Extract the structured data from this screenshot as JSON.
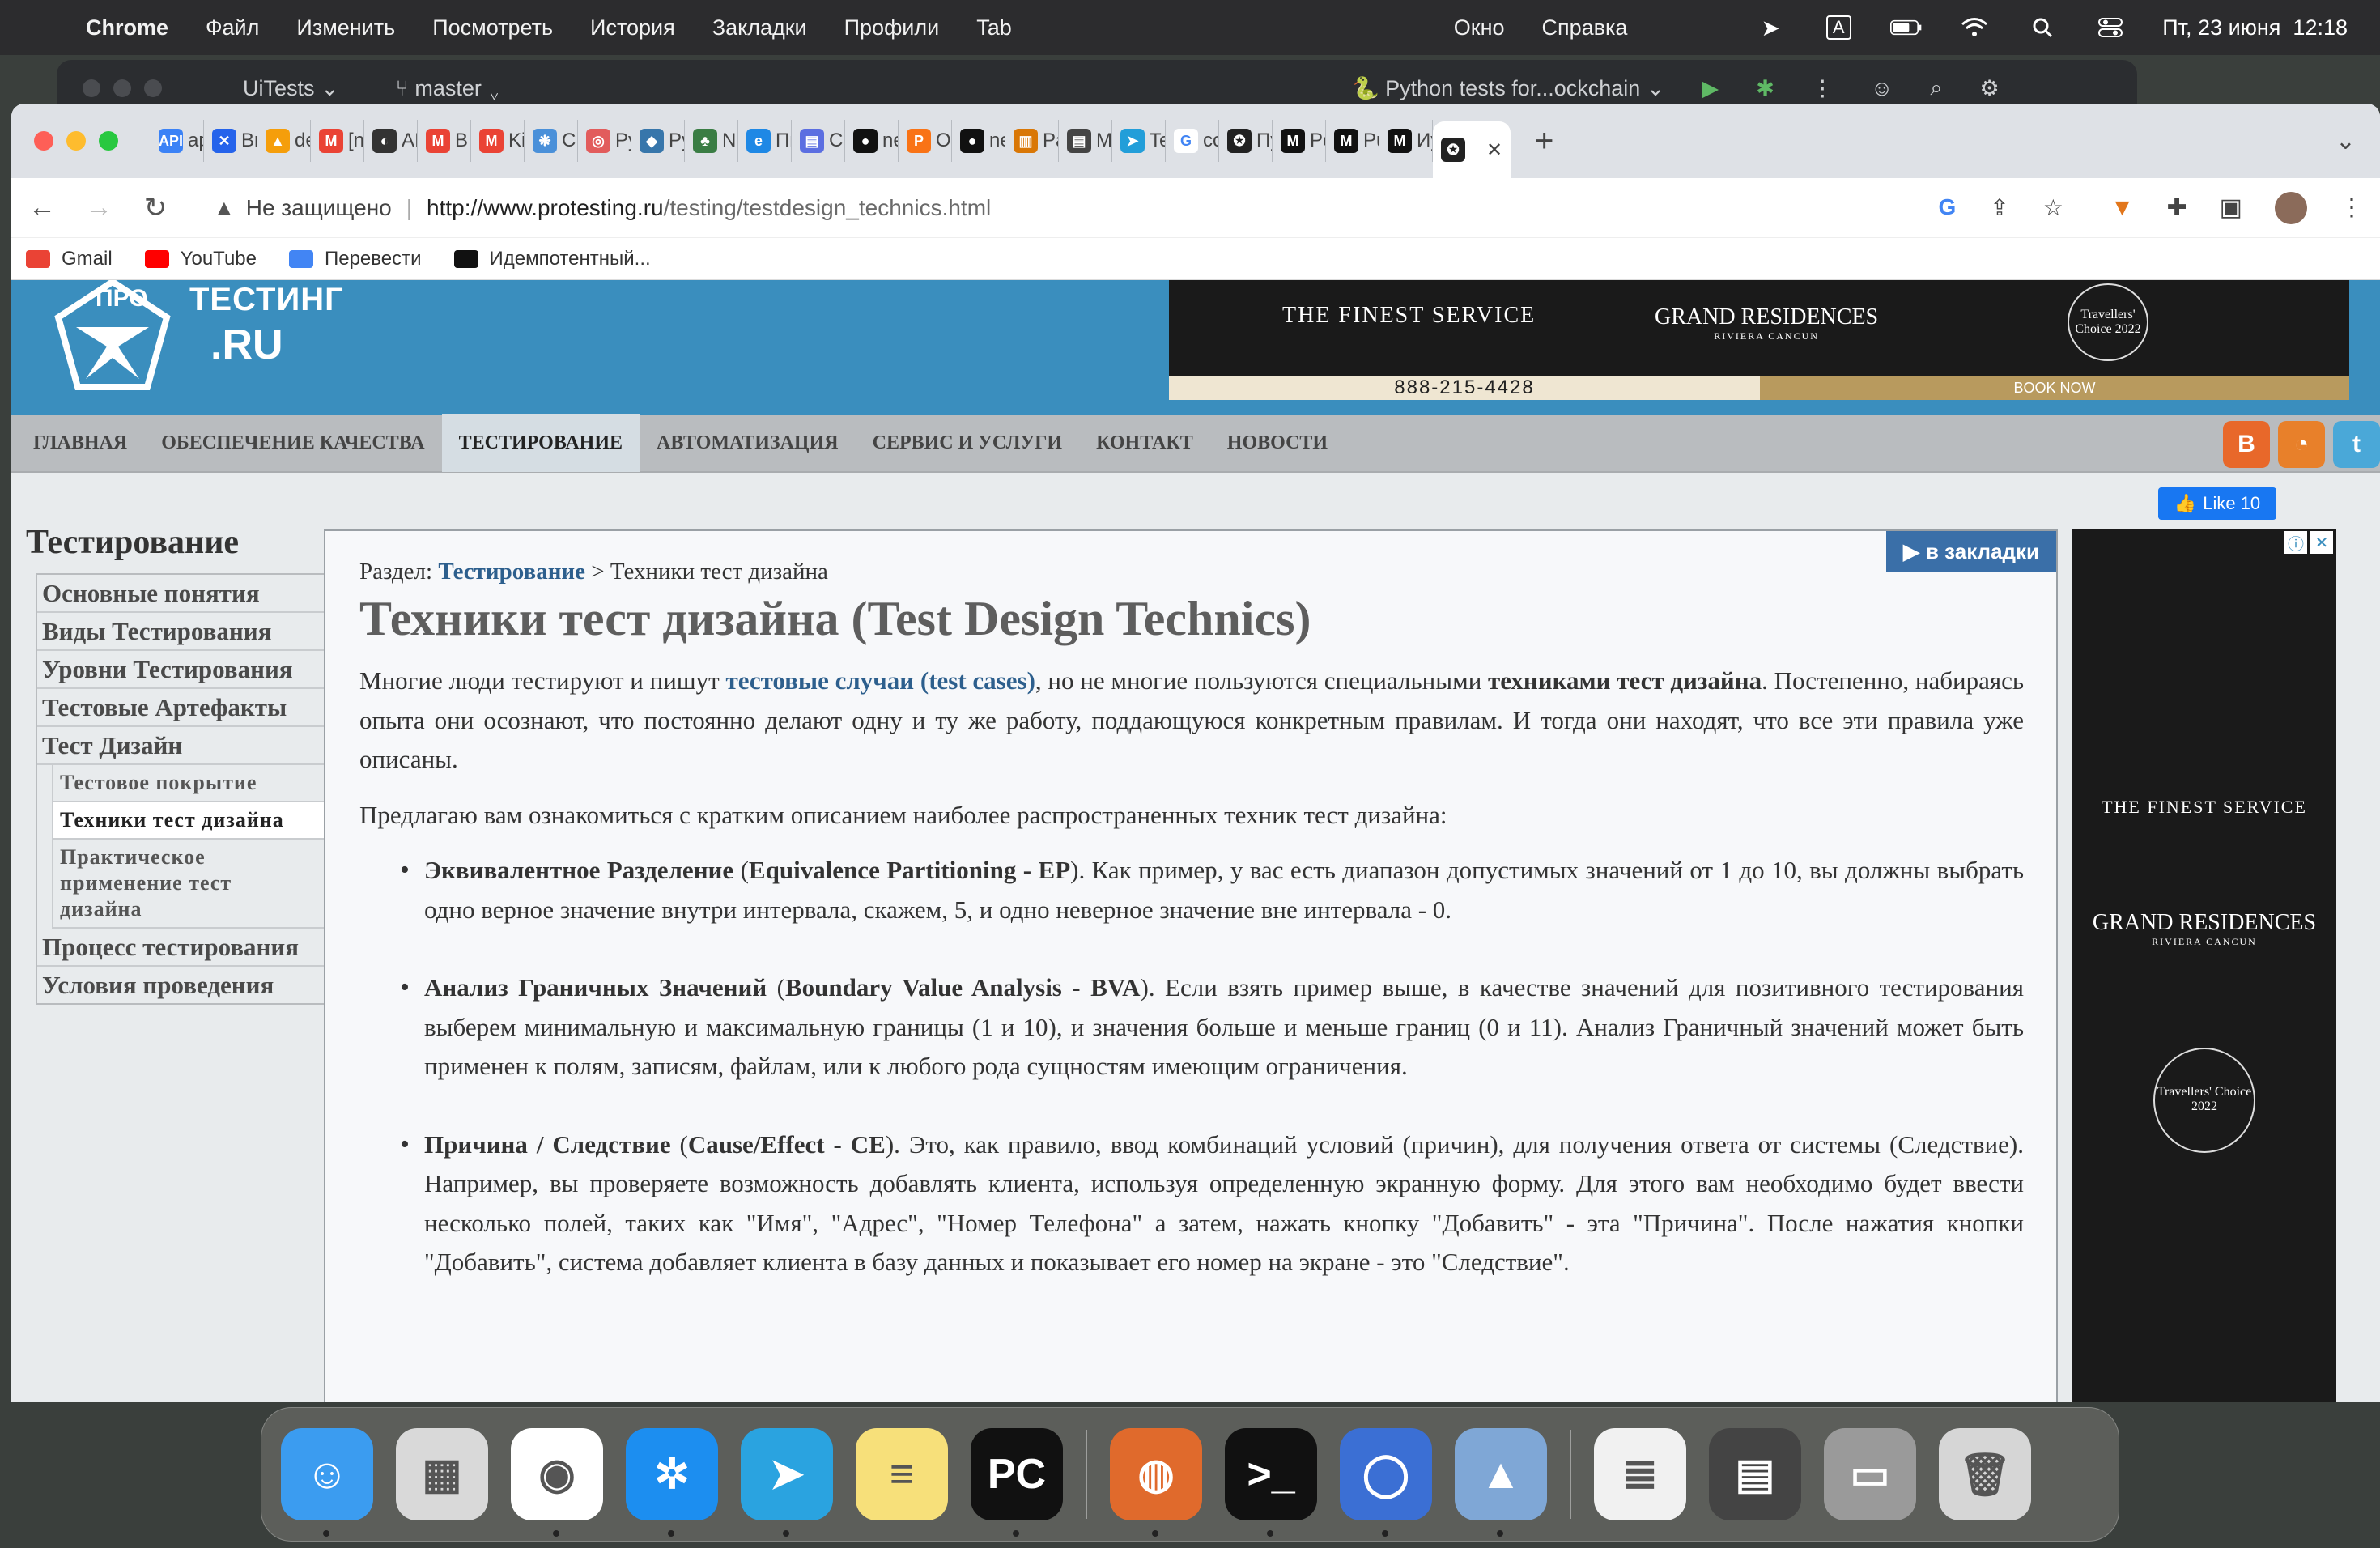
{
  "menubar": {
    "app": "Chrome",
    "items": [
      "Файл",
      "Изменить",
      "Посмотреть",
      "История",
      "Закладки",
      "Профили",
      "Tab"
    ],
    "right_items": [
      "Окно",
      "Справка"
    ],
    "input_source": "A",
    "datetime": "Пт, 23 июня  12:18"
  },
  "ide": {
    "project": "UiTests",
    "branch": "master",
    "run_config": "Python tests for...ockchain"
  },
  "tabs": [
    {
      "label": "ap",
      "color": "#3b82f6",
      "glyph": "API"
    },
    {
      "label": "Br",
      "color": "#2563eb",
      "glyph": "✕"
    },
    {
      "label": "de",
      "color": "#f59e0b",
      "glyph": "▲"
    },
    {
      "label": "[n",
      "color": "#ea4335",
      "glyph": "M"
    },
    {
      "label": "AI",
      "color": "#333333",
      "glyph": "◐"
    },
    {
      "label": "B:",
      "color": "#ea4335",
      "glyph": "M"
    },
    {
      "label": "Ki",
      "color": "#ea4335",
      "glyph": "M"
    },
    {
      "label": "C:",
      "color": "#4a90d9",
      "glyph": "❋"
    },
    {
      "label": "Py",
      "color": "#e25c5c",
      "glyph": "◎"
    },
    {
      "label": "Py",
      "color": "#3776ab",
      "glyph": "◆"
    },
    {
      "label": "N",
      "color": "#3a7d44",
      "glyph": "♣"
    },
    {
      "label": "Пи",
      "color": "#1e88e5",
      "glyph": "e"
    },
    {
      "label": "Ci",
      "color": "#5b6ee1",
      "glyph": "▤"
    },
    {
      "label": "ne",
      "color": "#111111",
      "glyph": "●"
    },
    {
      "label": "O",
      "color": "#f97316",
      "glyph": "P"
    },
    {
      "label": "ne",
      "color": "#111111",
      "glyph": "●"
    },
    {
      "label": "Pa",
      "color": "#d97706",
      "glyph": "▥"
    },
    {
      "label": "M",
      "color": "#444444",
      "glyph": "▤"
    },
    {
      "label": "Te",
      "color": "#229ed9",
      "glyph": "➤"
    },
    {
      "label": "co",
      "color": "#ffffff",
      "glyph": "G"
    },
    {
      "label": "Пу",
      "color": "#222222",
      "glyph": "✪"
    },
    {
      "label": "Po",
      "color": "#111111",
      "glyph": "M"
    },
    {
      "label": "Pu",
      "color": "#111111",
      "glyph": "M"
    },
    {
      "label": "Иу",
      "color": "#111111",
      "glyph": "M"
    },
    {
      "label": "",
      "color": "#222222",
      "glyph": "✪",
      "active": true
    }
  ],
  "omnibox": {
    "security": "Не защищено",
    "host": "http://www.protesting.ru",
    "path": "/testing/testdesign_technics.html"
  },
  "bookmarks": [
    {
      "label": "Gmail",
      "color": "#ea4335"
    },
    {
      "label": "YouTube",
      "color": "#ff0000"
    },
    {
      "label": "Перевести",
      "color": "#4285f4"
    },
    {
      "label": "Идемпотентный...",
      "color": "#111111"
    }
  ],
  "site": {
    "logo_top": "ПРО",
    "logo_mid": "ТЕСТИНГ",
    "logo_bottom": ".RU",
    "banner": {
      "slogan": "THE FINEST SERVICE",
      "brand": "GRAND RESIDENCES",
      "brand_sub": "RIVIERA CANCUN",
      "award": "Travellers' Choice 2022",
      "phone": "888-215-4428",
      "cta": "BOOK NOW"
    },
    "nav": [
      "ГЛАВНАЯ",
      "ОБЕСПЕЧЕНИЕ КАЧЕСТВА",
      "ТЕСТИРОВАНИЕ",
      "АВТОМАТИЗАЦИЯ",
      "СЕРВИС И УСЛУГИ",
      "КОНТАКТ",
      "НОВОСТИ"
    ],
    "fb_like": "Like 10",
    "bookmark_btn": "в закладки"
  },
  "sidebar": {
    "title": "Тестирование",
    "items": [
      "Основные понятия",
      "Виды Тестирования",
      "Уровни Тестирования",
      "Тестовые Артефакты",
      "Тест Дизайн"
    ],
    "subitems": [
      "Тестовое покрытие",
      "Техники тест дизайна",
      "Практическое применение тест дизайна"
    ],
    "items_after": [
      "Процесс тестирования",
      "Условия проведения"
    ]
  },
  "article": {
    "crumb_label": "Раздел:",
    "crumb_link": "Тестирование",
    "crumb_rest": "> Техники тест дизайна",
    "title": "Техники тест дизайна (Test Design Technics)",
    "p1_a": "Многие люди тестируют и пишут ",
    "p1_link": "тестовые случаи (test cases)",
    "p1_b": ", но не многие пользуются специальными ",
    "p1_bold": "техниками тест дизайна",
    "p1_c": ". Постепенно, набираясь опыта они осознают, что постоянно делают одну и ту же работу, поддающуюся конкретным правилам. И тогда они находят, что все эти правила уже описаны.",
    "p2": "Предлагаю вам ознакомиться с кратким описанием наиболее распространенных техник тест дизайна:",
    "li1_bold": "Эквивалентное Разделение",
    "li1_en": "Equivalence Partitioning - EP",
    "li1_text": ". Как пример, у вас есть диапазон допустимых значений от 1 до 10, вы должны выбрать одно верное значение внутри интервала, скажем, 5, и одно неверное значение вне интервала - 0.",
    "li2_bold": "Анализ Граничных Значений",
    "li2_en": "Boundary Value Analysis - BVA",
    "li2_text": ". Если взять пример выше, в качестве значений для позитивного тестирования выберем минимальную и максимальную границы (1 и 10), и значения больше и меньше границ (0 и 11). Анализ Граничный значений может быть применен к полям, записям, файлам, или к любого рода сущностям имеющим ограничения.",
    "li3_bold": "Причина / Следствие",
    "li3_en": "Cause/Effect - CE",
    "li3_text": ". Это, как правило, ввод комбинаций условий (причин), для получения ответа от системы (Следствие). Например, вы проверяете возможность добавлять клиента, используя определенную экранную форму. Для этого вам необходимо будет ввести несколько полей, таких как \"Имя\", \"Адрес\", \"Номер Телефона\" а затем, нажать кнопку \"Добавить\" - эта \"Причина\". После нажатия кнопки \"Добавить\", система добавляет клиента в базу данных и показывает его номер на экране - это \"Следствие\"."
  },
  "dock": [
    {
      "name": "finder",
      "color": "#3b9cf0",
      "glyph": "☺"
    },
    {
      "name": "launchpad",
      "color": "#d9d9d9",
      "glyph": "▦"
    },
    {
      "name": "chrome",
      "color": "#ffffff",
      "glyph": "◉"
    },
    {
      "name": "safari",
      "color": "#1c8ef0",
      "glyph": "✲"
    },
    {
      "name": "telegram",
      "color": "#2aa3e0",
      "glyph": "➤"
    },
    {
      "name": "notes",
      "color": "#f7e07a",
      "glyph": "≡"
    },
    {
      "name": "pycharm",
      "color": "#111111",
      "glyph": "PC"
    },
    {
      "name": "postman-orange",
      "color": "#e06a2c",
      "glyph": "◍"
    },
    {
      "name": "terminal",
      "color": "#111111",
      "glyph": ">_"
    },
    {
      "name": "chromium",
      "color": "#3b6fd4",
      "glyph": "◯"
    },
    {
      "name": "preview",
      "color": "#7fa7d6",
      "glyph": "▲"
    },
    {
      "name": "doc-thumb",
      "color": "#f1f1f1",
      "glyph": "≣"
    },
    {
      "name": "window-thumb",
      "color": "#444444",
      "glyph": "▤"
    },
    {
      "name": "downloads-thumb",
      "color": "#9a9a9a",
      "glyph": "▭"
    },
    {
      "name": "trash",
      "color": "#d6d6d6",
      "glyph": "🗑"
    }
  ]
}
